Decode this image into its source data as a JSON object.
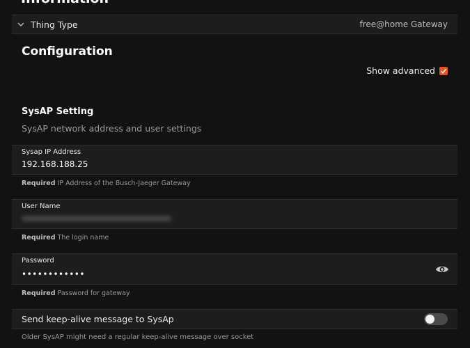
{
  "information": {
    "title": "Information"
  },
  "thing_type": {
    "label": "Thing Type",
    "value": "free@home Gateway"
  },
  "configuration": {
    "title": "Configuration",
    "show_advanced_label": "Show advanced",
    "show_advanced_checked": true
  },
  "sysap_setting": {
    "title": "SysAP Setting",
    "description": "SysAP network address and user settings"
  },
  "fields": {
    "ip": {
      "label": "Sysap IP Address",
      "value": "192.168.188.25",
      "required": "Required",
      "hint": " IP Address of the Busch-Jaeger Gateway"
    },
    "username": {
      "label": "User Name",
      "required": "Required",
      "hint": " The login name"
    },
    "password": {
      "label": "Password",
      "value": "••••••••••••",
      "required": "Required",
      "hint": " Password for gateway"
    }
  },
  "keepalive": {
    "label": "Send keep-alive message to SysAp",
    "enabled": false,
    "hint": "Older SysAP might need a regular keep-alive message over socket"
  },
  "icons": {
    "thing_type": "chevron-down-icon",
    "password": "eye-icon",
    "show_advanced": "checkmark-icon"
  },
  "colors": {
    "accent": "#e9531e",
    "background": "#121212",
    "panel": "#1d1d1d"
  }
}
